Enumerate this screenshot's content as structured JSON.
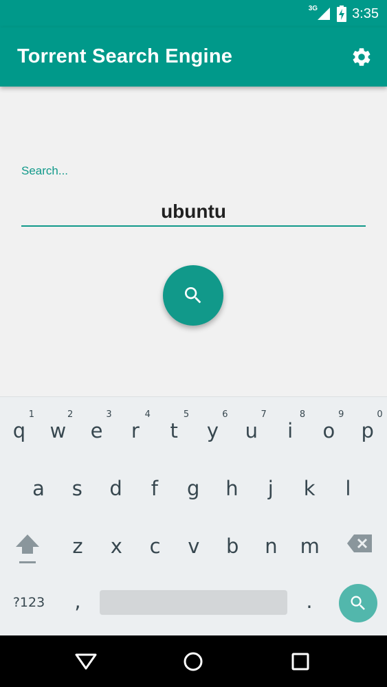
{
  "status_bar": {
    "network": "3G",
    "time": "3:35"
  },
  "app_bar": {
    "title": "Torrent Search Engine",
    "settings_icon": "gear-icon"
  },
  "search": {
    "label": "Search...",
    "value": "ubuntu",
    "button_icon": "search-icon"
  },
  "keyboard": {
    "row1": [
      {
        "key": "q",
        "hint": "1"
      },
      {
        "key": "w",
        "hint": "2"
      },
      {
        "key": "e",
        "hint": "3"
      },
      {
        "key": "r",
        "hint": "4"
      },
      {
        "key": "t",
        "hint": "5"
      },
      {
        "key": "y",
        "hint": "6"
      },
      {
        "key": "u",
        "hint": "7"
      },
      {
        "key": "i",
        "hint": "8"
      },
      {
        "key": "o",
        "hint": "9"
      },
      {
        "key": "p",
        "hint": "0"
      }
    ],
    "row2": [
      "a",
      "s",
      "d",
      "f",
      "g",
      "h",
      "j",
      "k",
      "l"
    ],
    "row3": [
      "z",
      "x",
      "c",
      "v",
      "b",
      "n",
      "m"
    ],
    "symbols_label": "?123",
    "comma": ",",
    "period": ".",
    "shift_icon": "shift-icon",
    "delete_icon": "backspace-icon",
    "enter_icon": "search-icon"
  },
  "nav_bar": {
    "back_icon": "back-icon",
    "home_icon": "home-icon",
    "recents_icon": "recents-icon"
  },
  "colors": {
    "primary": "#00998a",
    "accent": "#11998a",
    "keyboard_bg": "#eceff1"
  }
}
